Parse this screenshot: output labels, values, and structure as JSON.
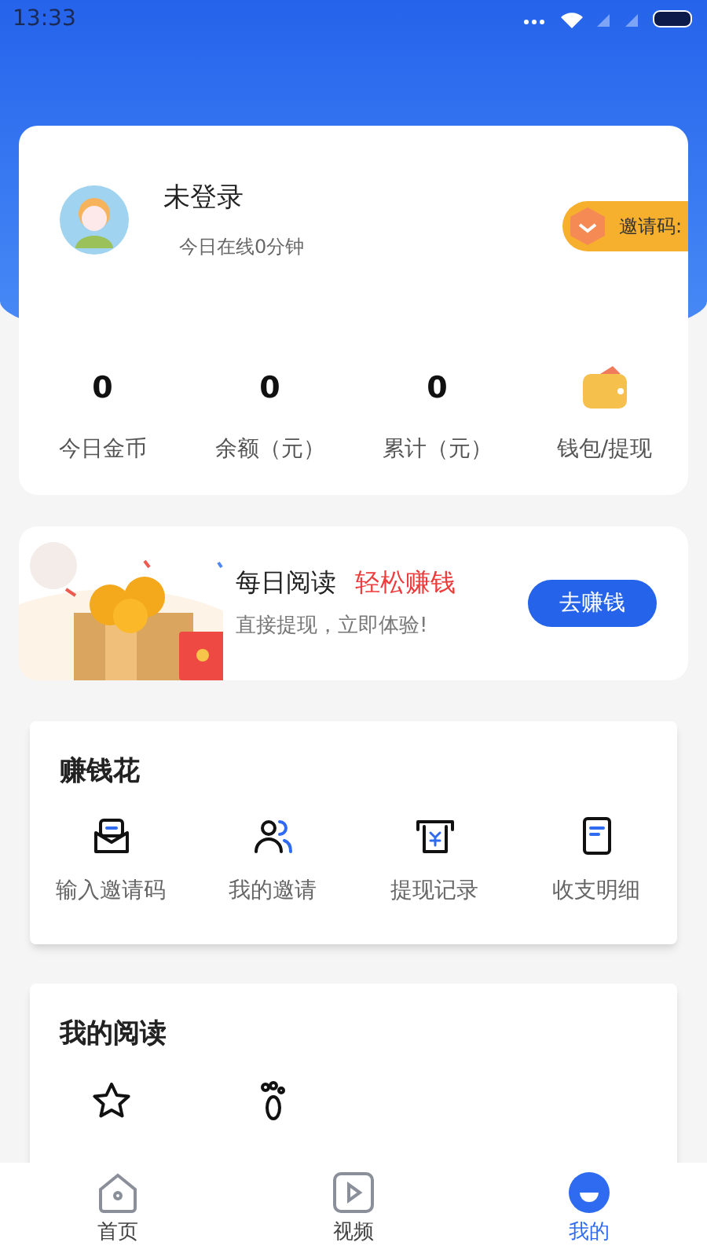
{
  "status_bar": {
    "time": "13:33"
  },
  "profile": {
    "name": "未登录",
    "online": "今日在线0分钟",
    "invite_badge": "邀请码:"
  },
  "stats": [
    {
      "kind": "value",
      "value": "0",
      "label": "今日金币"
    },
    {
      "kind": "value",
      "value": "0",
      "label": "余额（元）"
    },
    {
      "kind": "value",
      "value": "0",
      "label": "累计（元）"
    },
    {
      "kind": "wallet",
      "label": "钱包/提现"
    }
  ],
  "banner": {
    "title": "每日阅读",
    "highlight": "轻松赚钱",
    "subtitle": "直接提现，立即体验!",
    "button": "去赚钱"
  },
  "earn_section": {
    "title": "赚钱花",
    "items": [
      {
        "kind": "envelope",
        "label": "输入邀请码"
      },
      {
        "kind": "people",
        "label": "我的邀请"
      },
      {
        "kind": "receipt",
        "label": "提现记录"
      },
      {
        "kind": "document",
        "label": "收支明细"
      }
    ]
  },
  "reading_section": {
    "title": "我的阅读",
    "items": [
      {
        "kind": "star"
      },
      {
        "kind": "footprint"
      }
    ]
  },
  "bottom_nav": [
    {
      "kind": "home",
      "label": "首页",
      "selected": false
    },
    {
      "kind": "video",
      "label": "视频",
      "selected": false
    },
    {
      "kind": "me",
      "label": "我的",
      "selected": true
    }
  ]
}
